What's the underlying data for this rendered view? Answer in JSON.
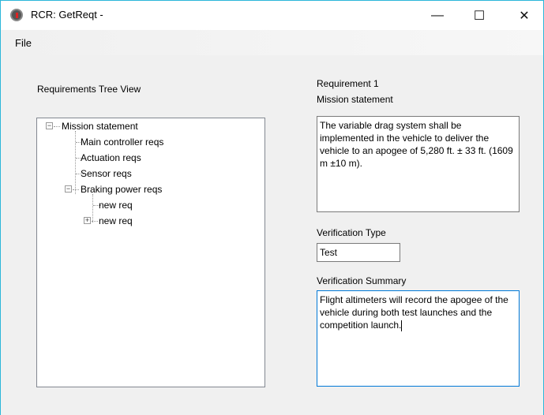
{
  "window": {
    "title": "RCR: GetReqt -",
    "minimize": "—",
    "maximize": "☐",
    "close": "✕"
  },
  "menu": {
    "file": "File"
  },
  "tree": {
    "label": "Requirements Tree View",
    "root": {
      "label": "Mission statement",
      "expanded": true
    },
    "children": [
      {
        "label": "Main controller reqs"
      },
      {
        "label": "Actuation reqs"
      },
      {
        "label": "Sensor reqs"
      },
      {
        "label": "Braking power reqs",
        "expanded": true
      }
    ],
    "grandchildren": [
      {
        "label": "new req"
      },
      {
        "label": "new req",
        "collapsed": true
      }
    ]
  },
  "detail": {
    "req_number": "Requirement 1",
    "req_name": "Mission statement",
    "statement": "The variable drag system shall be implemented in the vehicle to deliver the vehicle to an apogee of 5,280 ft.  ± 33 ft. (1609 m ±10 m).",
    "verification_type_label": "Verification Type",
    "verification_type": "Test",
    "verification_summary_label": "Verification Summary",
    "verification_summary": "Flight altimeters will record the apogee of the vehicle during both test launches and the competition launch."
  }
}
